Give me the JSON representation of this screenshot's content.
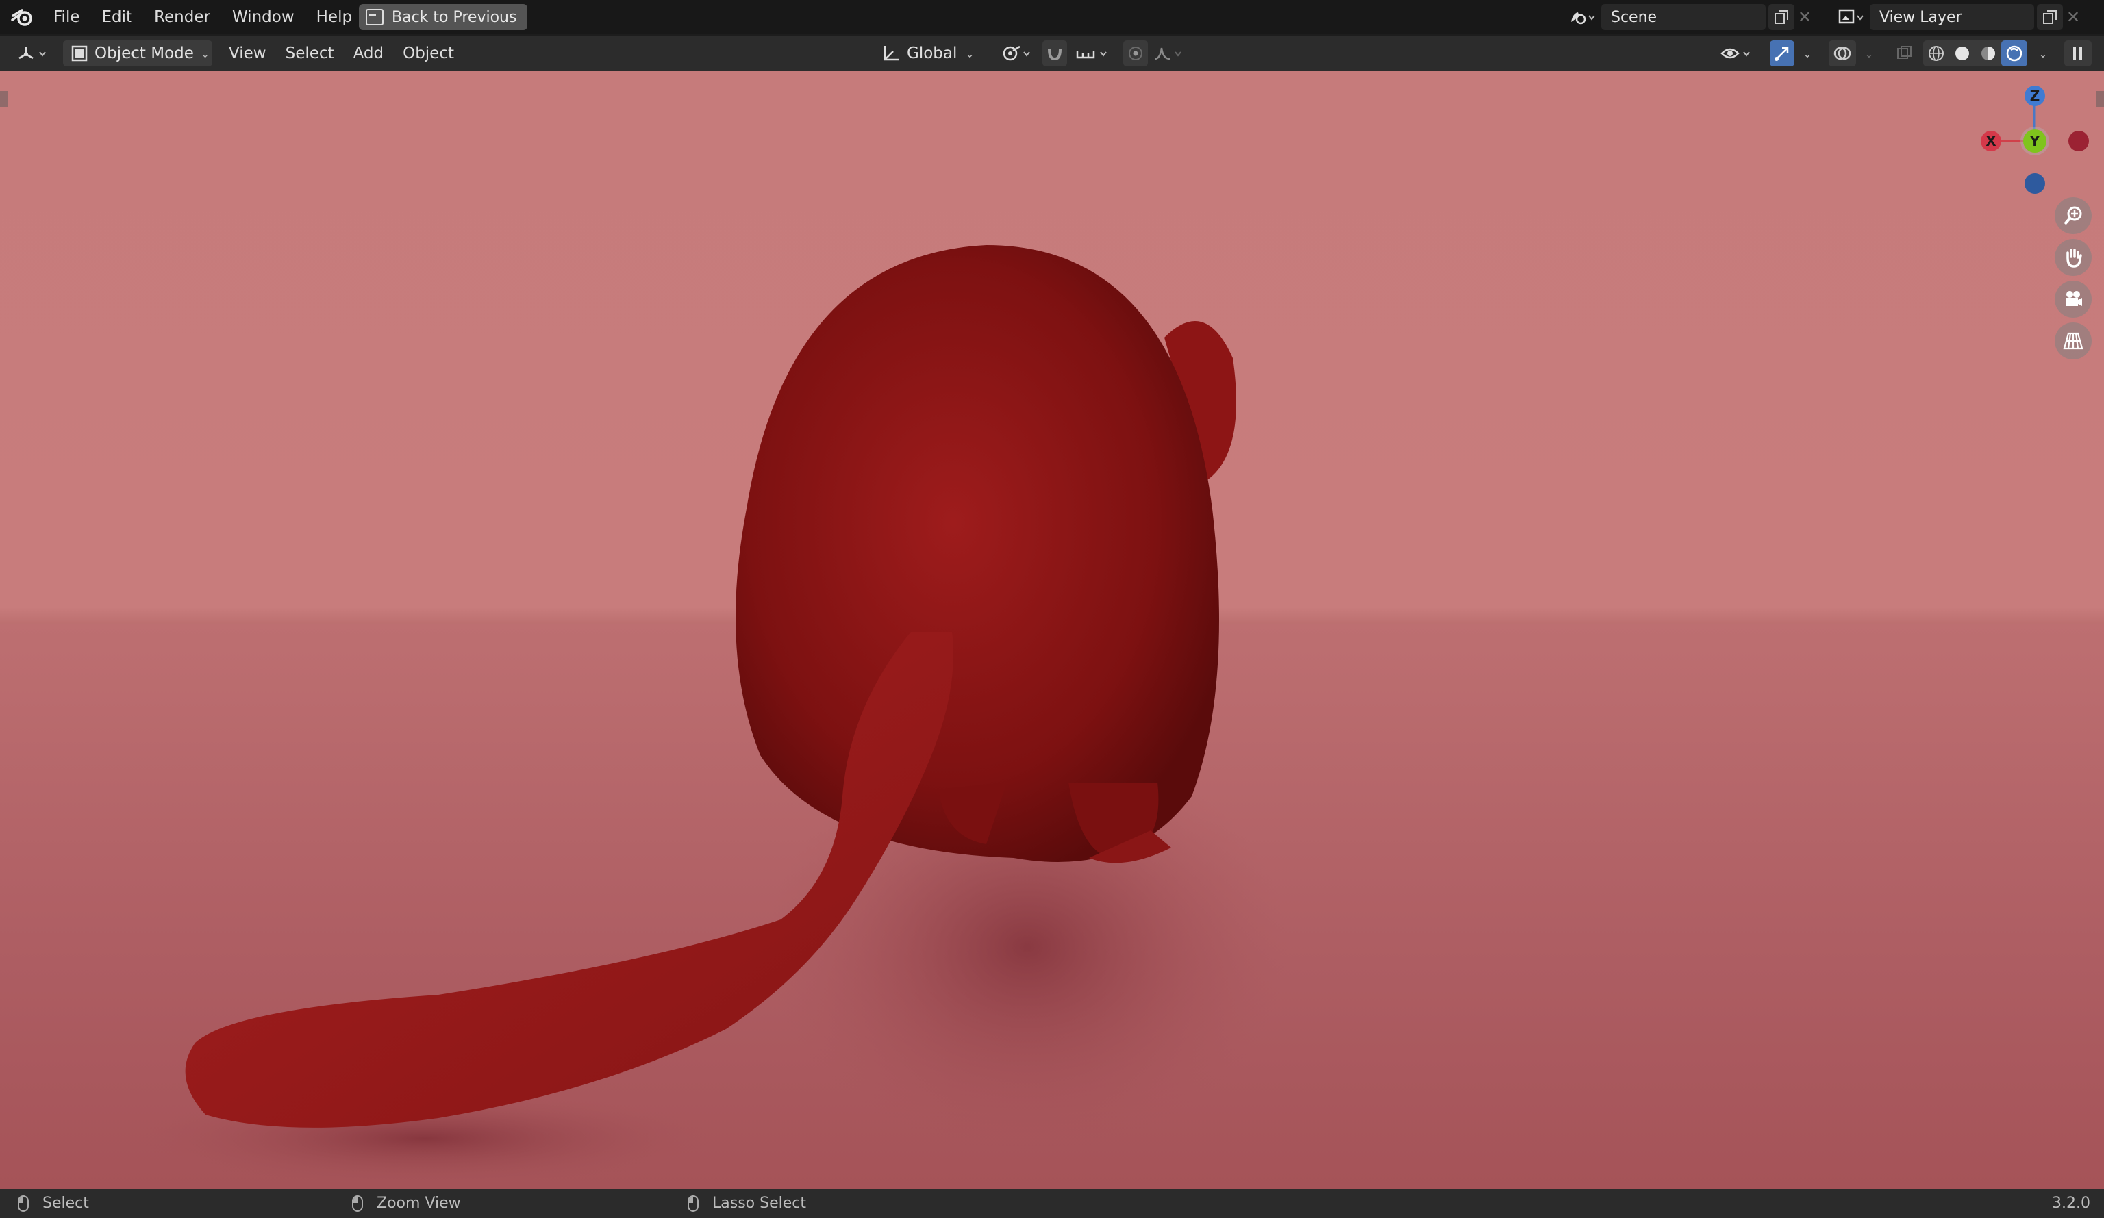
{
  "menubar": {
    "items": [
      "File",
      "Edit",
      "Render",
      "Window",
      "Help"
    ],
    "back_label": "Back to Previous",
    "scene_label": "Scene",
    "view_layer_label": "View Layer"
  },
  "toolbar": {
    "mode_label": "Object Mode",
    "menus": [
      "View",
      "Select",
      "Add",
      "Object"
    ],
    "transform_orientation": "Global"
  },
  "gizmo": {
    "x": "X",
    "y": "Y",
    "z": "Z"
  },
  "statusbar": {
    "select_label": "Select",
    "zoom_label": "Zoom View",
    "lasso_label": "Lasso Select",
    "version": "3.2.0"
  },
  "colors": {
    "viewport_bg": "#c67b7b",
    "creature": "#8a1414",
    "accent": "#4772b3"
  }
}
